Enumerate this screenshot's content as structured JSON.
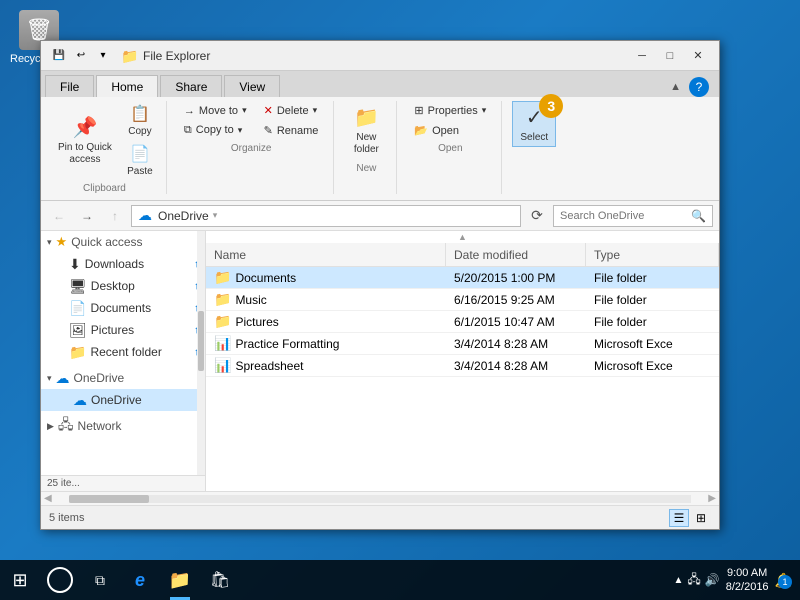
{
  "desktop": {
    "recycle_bin_label": "Recycle Bin"
  },
  "window": {
    "title": "File Explorer",
    "title_bar_text": "↑ · File Explorer"
  },
  "tabs": [
    {
      "id": "file",
      "label": "File",
      "active": false
    },
    {
      "id": "home",
      "label": "Home",
      "active": true
    },
    {
      "id": "share",
      "label": "Share",
      "active": false
    },
    {
      "id": "view",
      "label": "View",
      "active": false
    }
  ],
  "ribbon": {
    "groups": [
      {
        "name": "Clipboard",
        "items": [
          {
            "id": "pin",
            "label": "Pin to Quick\naccess",
            "icon": "📌"
          },
          {
            "id": "copy",
            "label": "Copy",
            "icon": "📋"
          },
          {
            "id": "paste",
            "label": "Paste",
            "icon": "📄"
          }
        ]
      },
      {
        "name": "Organize",
        "items_col1": [
          {
            "id": "move-to",
            "label": "Move to",
            "icon": "→"
          },
          {
            "id": "copy-to",
            "label": "Copy to",
            "icon": "⧉"
          }
        ],
        "items_col2": [
          {
            "id": "delete",
            "label": "Delete",
            "icon": "✕"
          },
          {
            "id": "rename",
            "label": "Rename",
            "icon": "✎"
          }
        ]
      },
      {
        "name": "New",
        "items": [
          {
            "id": "new-folder",
            "label": "New\nfolder",
            "icon": "📁"
          }
        ]
      },
      {
        "name": "Open",
        "items_col": [
          {
            "id": "properties",
            "label": "Properties",
            "icon": "⊞"
          }
        ]
      },
      {
        "name": "",
        "items": [
          {
            "id": "select",
            "label": "Select",
            "icon": "✓",
            "active": true,
            "badge": "3"
          }
        ]
      }
    ]
  },
  "address_bar": {
    "path": "OneDrive",
    "path_icon": "☁",
    "breadcrumb": "OneDrive",
    "search_placeholder": "Search OneDrive"
  },
  "nav_pane": {
    "sections": [
      {
        "id": "quick-access",
        "header": "Quick access",
        "items": [
          {
            "id": "downloads",
            "label": "Downloads",
            "icon": "⬇",
            "has_arrow": true
          },
          {
            "id": "desktop",
            "label": "Desktop",
            "icon": "🖥",
            "has_arrow": true
          },
          {
            "id": "documents",
            "label": "Documents",
            "icon": "📄",
            "has_arrow": true
          },
          {
            "id": "pictures",
            "label": "Pictures",
            "icon": "🖼",
            "has_arrow": true
          },
          {
            "id": "recent-folder",
            "label": "Recent folder",
            "icon": "📁",
            "has_arrow": true
          }
        ]
      },
      {
        "id": "onedrive-section",
        "items": [
          {
            "id": "onedrive",
            "label": "OneDrive",
            "icon": "☁",
            "selected": true
          }
        ]
      },
      {
        "id": "this-pc",
        "items": []
      },
      {
        "id": "network",
        "items": [
          {
            "id": "network",
            "label": "Network",
            "icon": "🖧"
          }
        ]
      }
    ],
    "footer_count": "25 ite..."
  },
  "file_list": {
    "columns": [
      {
        "id": "name",
        "label": "Name"
      },
      {
        "id": "date-modified",
        "label": "Date modified"
      },
      {
        "id": "type",
        "label": "Type"
      }
    ],
    "files": [
      {
        "id": "documents",
        "name": "Documents",
        "icon": "📁",
        "date": "5/20/2015 1:00 PM",
        "type": "File folder",
        "selected": true
      },
      {
        "id": "music",
        "name": "Music",
        "icon": "📁",
        "date": "6/16/2015 9:25 AM",
        "type": "File folder",
        "selected": false
      },
      {
        "id": "pictures",
        "name": "Pictures",
        "icon": "📁",
        "date": "6/1/2015 10:47 AM",
        "type": "File folder",
        "selected": false
      },
      {
        "id": "practice-formatting",
        "name": "Practice Formatting",
        "icon": "📊",
        "date": "3/4/2014 8:28 AM",
        "type": "Microsoft Exce",
        "selected": false
      },
      {
        "id": "spreadsheet",
        "name": "Spreadsheet",
        "icon": "📊",
        "date": "3/4/2014 8:28 AM",
        "type": "Microsoft Exce",
        "selected": false
      }
    ]
  },
  "status_bar": {
    "count": "5 items",
    "view_icons": [
      "⊞",
      "☰"
    ]
  },
  "taskbar": {
    "start_icon": "⊞",
    "search_icon": "⚪",
    "task_view_icon": "⧉",
    "edge_icon": "e",
    "explorer_icon": "📁",
    "store_icon": "🛍",
    "time": "9:00 AM",
    "date": "8/2/2016",
    "notification_count": "1"
  },
  "title_btn": {
    "minimize": "─",
    "maximize": "□",
    "close": "✕"
  }
}
